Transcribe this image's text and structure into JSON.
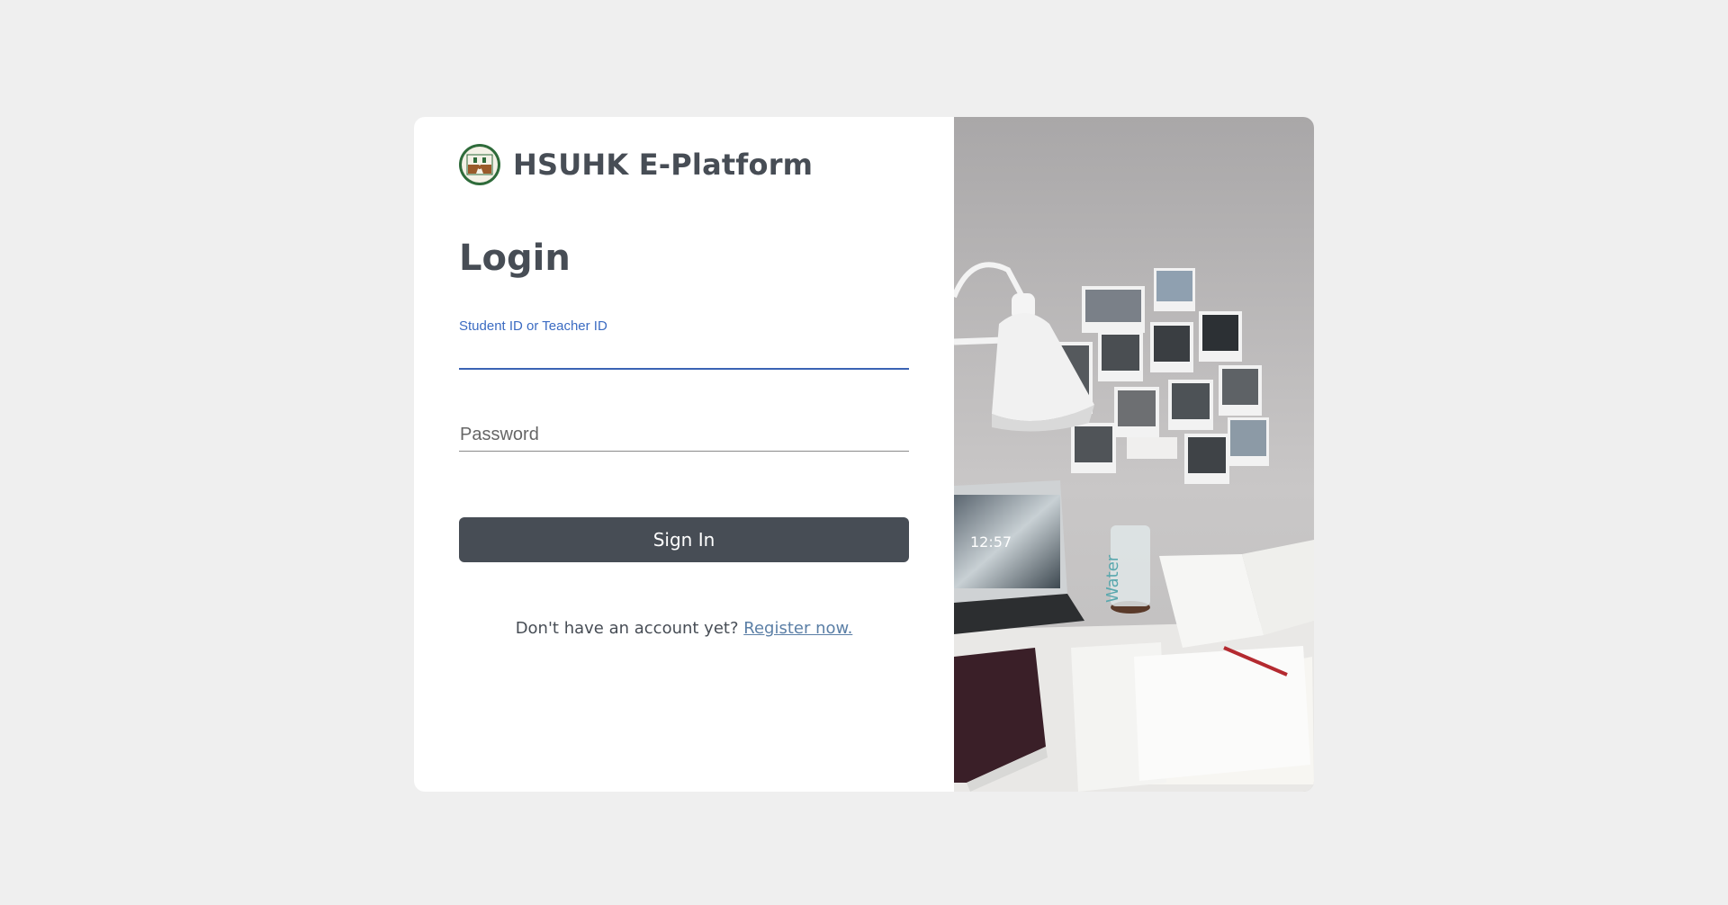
{
  "brand": {
    "title": "HSUHK E-Platform"
  },
  "login": {
    "title": "Login",
    "id_label": "Student ID or Teacher ID",
    "password_placeholder": "Password",
    "signin_label": "Sign In",
    "register_prompt": "Don't have an account yet?",
    "register_link": "Register now."
  },
  "photo": {
    "laptop_clock": "12:57",
    "cup_text": "Water"
  },
  "colors": {
    "background": "#efefef",
    "primary": "#474d55",
    "focus_blue": "#3b63b4",
    "link": "#5b7fa6",
    "logo_green": "#2e6b3a"
  }
}
